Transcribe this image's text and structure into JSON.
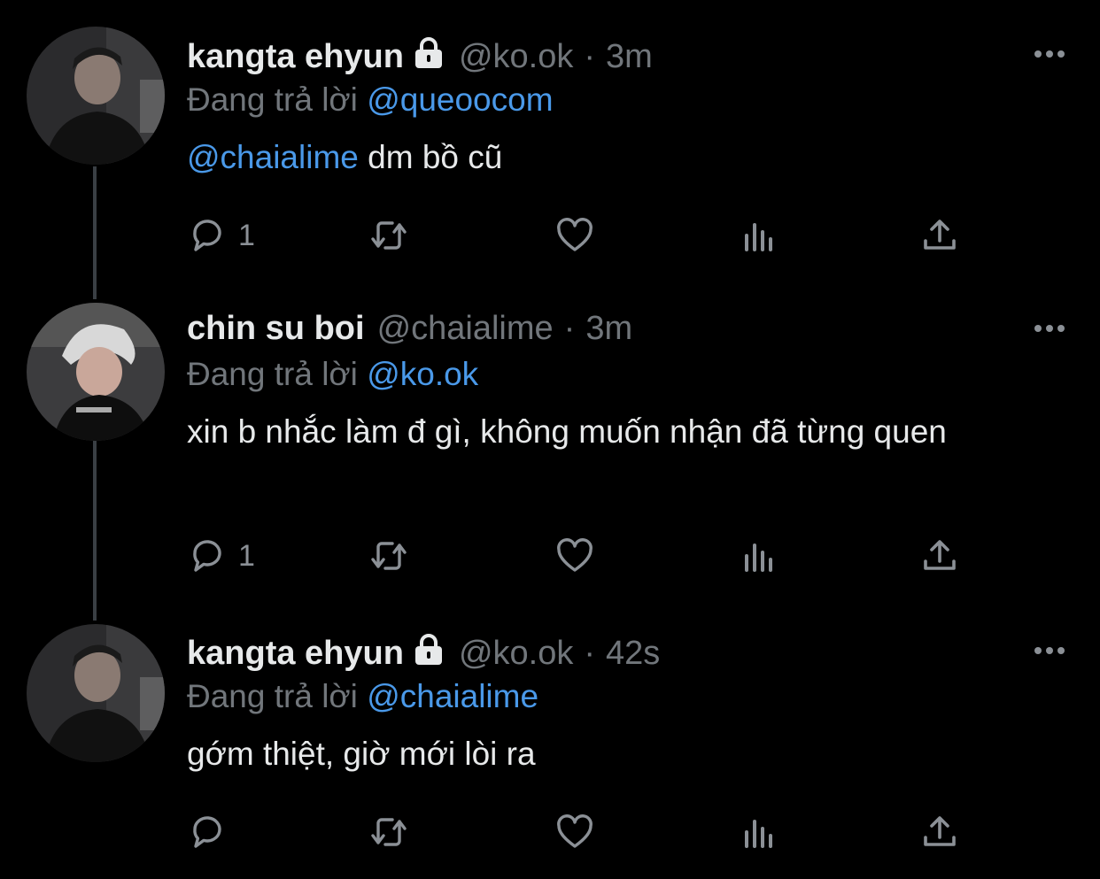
{
  "tweets": [
    {
      "name": "kangta ehyun",
      "protected": true,
      "handle": "@ko.ok",
      "separator": "·",
      "time": "3m",
      "reply_prefix": "Đang trả lời",
      "reply_to": "@queoocom",
      "text_mention": "@chaialime",
      "text": " dm bồ cũ",
      "reply_count": "1"
    },
    {
      "name": "chin su boi",
      "protected": false,
      "handle": "@chaialime",
      "separator": "·",
      "time": "3m",
      "reply_prefix": "Đang trả lời",
      "reply_to": "@ko.ok",
      "text_mention": "",
      "text": "xin b nhắc làm đ gì, không muốn nhận đã từng quen",
      "reply_count": "1"
    },
    {
      "name": "kangta ehyun",
      "protected": true,
      "handle": "@ko.ok",
      "separator": "·",
      "time": "42s",
      "reply_prefix": "Đang trả lời",
      "reply_to": "@chaialime",
      "text_mention": "",
      "text": "gớm thiệt, giờ mới lòi ra",
      "reply_count": ""
    }
  ],
  "icons": [
    "reply-icon",
    "retweet-icon",
    "like-icon",
    "views-icon",
    "share-icon",
    "lock-icon",
    "more-icon"
  ],
  "colors": {
    "background": "#000000",
    "text": "#e7e9ea",
    "muted": "#71767b",
    "link": "#4a99e9",
    "thread": "#3a3f44"
  }
}
